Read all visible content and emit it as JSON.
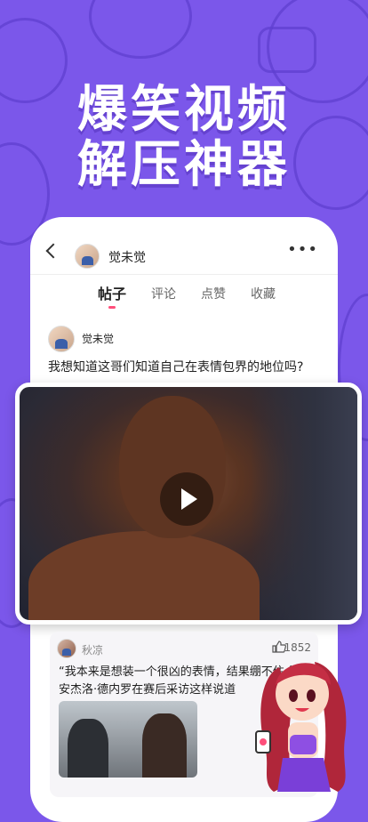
{
  "headline": {
    "line1": "爆笑视频",
    "line2": "解压神器"
  },
  "topbar": {
    "back_label": "",
    "username": "觉未觉",
    "more_label": "•••"
  },
  "tabs": [
    {
      "label": "帖子",
      "active": true
    },
    {
      "label": "评论",
      "active": false
    },
    {
      "label": "点赞",
      "active": false
    },
    {
      "label": "收藏",
      "active": false
    }
  ],
  "post": {
    "author": "觉未觉",
    "text": "我想知道这哥们知道自己在表情包界的地位吗?"
  },
  "comment": {
    "author": "秋凉",
    "likes": "1852",
    "text": "“我本来是想装一个很凶的表情，结果绷不住 德安杰洛·德内罗在赛后采访这样说道"
  },
  "colors": {
    "background": "#7b57ea",
    "accent": "#ff4f7b"
  },
  "icons": [
    "back-icon",
    "more-icon",
    "play-icon",
    "thumbs-up-icon"
  ]
}
